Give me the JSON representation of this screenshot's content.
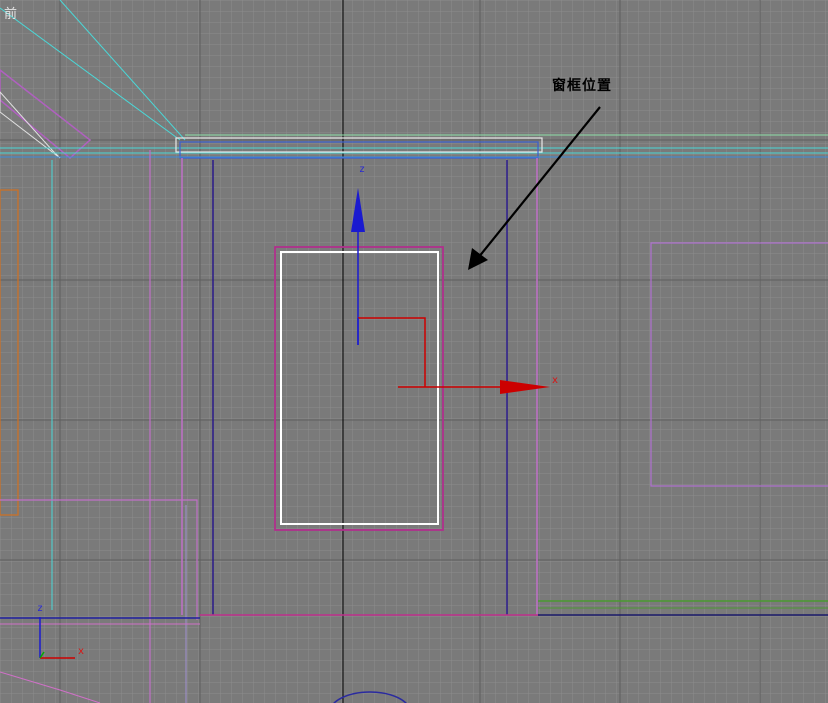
{
  "viewport": {
    "name": "前",
    "annotation": "窗框位置",
    "gizmo": {
      "z_label": "z",
      "x_label": "x"
    },
    "axis_tripod": {
      "z_label": "z",
      "x_label": "x"
    }
  },
  "colors": {
    "background": "#7a7a7a",
    "grid_minor": "#8a8a8a",
    "grid_major": "#5c5c5c",
    "selected_frame": "#ffffff",
    "window_outline": "#b0308c",
    "wall_lines": "#2a1a8a",
    "sill_cyan": "#4ad8d8",
    "gizmo_x": "#cc0000",
    "gizmo_z": "#0000cc",
    "gizmo_y": "#00aa00"
  },
  "icons": [
    "move-gizmo-icon",
    "axis-tripod-icon",
    "annotation-arrow-icon"
  ]
}
